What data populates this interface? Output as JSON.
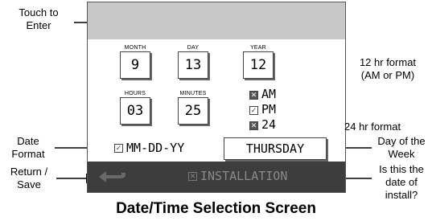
{
  "annotations": {
    "touch_to_enter": [
      "Touch to",
      "Enter"
    ],
    "hr12": [
      "12 hr format",
      "(AM or PM)"
    ],
    "hr24": "24 hr format",
    "date_format": [
      "Date",
      "Format"
    ],
    "day_of_week": [
      "Day of the",
      "Week"
    ],
    "return_save": [
      "Return /",
      "Save"
    ],
    "date_of_install": [
      "Is this the",
      "date of",
      "install?"
    ]
  },
  "fields": {
    "month": {
      "label": "MONTH",
      "value": "9"
    },
    "day": {
      "label": "DAY",
      "value": "13"
    },
    "year": {
      "label": "YEAR",
      "value": "12"
    },
    "hours": {
      "label": "HOURS",
      "value": "03"
    },
    "minutes": {
      "label": "MINUTES",
      "value": "25"
    }
  },
  "time_format": {
    "am": "AM",
    "pm": "PM",
    "h24": "24"
  },
  "date_format_value": "MM-DD-YY",
  "day_of_week_value": "THURSDAY",
  "installation_label": "INSTALLATION",
  "caption": "Date/Time Selection Screen",
  "colors": {
    "top_band": "#c8c8c8",
    "bottom_bar": "#3d3d3d"
  }
}
